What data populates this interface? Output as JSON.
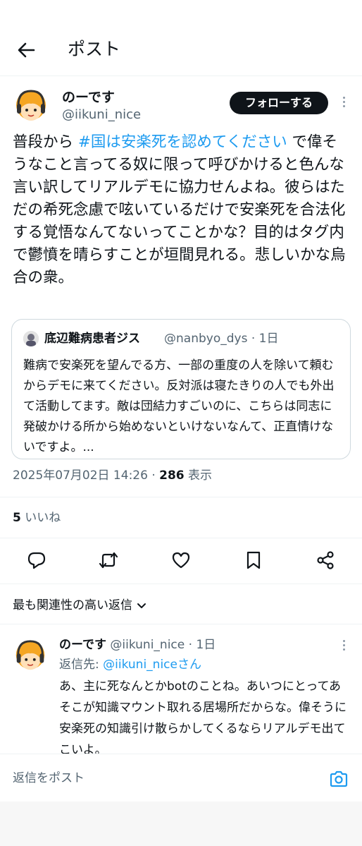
{
  "header": {
    "title": "ポスト"
  },
  "post": {
    "author": {
      "name": "のーです",
      "handle": "@iikuni_nice"
    },
    "follow_label": "フォローする",
    "text_before": "普段から ",
    "hashtag": "#国は安楽死を認めてください",
    "text_after": " で偉そうなこと言ってる奴に限って呼びかけると色んな言い訳してリアルデモに協力せんよね。彼らはただの希死念慮で呟いているだけで安楽死を合法化する覚悟なんてないってことかな？目的はタグ内で鬱憤を晴らすことが垣間見れる。悲しいかな烏合の衆。",
    "quote": {
      "name": "底辺難病患者ジス",
      "meta": "@nanbyo_dys · 1日",
      "text": "難病で安楽死を望んでる方、一部の重度の人を除いて頼むからデモに来てください。反対派は寝たきりの人でも外出て活動してます。敵は団結力すごいのに、こちらは同志に発破かける所から始めないといけないなんて、正直情けないですよ。..."
    },
    "timestamp": "2025年07月02日 14:26 · ",
    "views_count": "286",
    "views_label": " 表示",
    "likes_count": "5",
    "likes_label": " いいね"
  },
  "replies": {
    "sort_label": "最も関連性の高い返信",
    "items": [
      {
        "name": "のーです",
        "meta": " @iikuni_nice · 1日",
        "reply_to_prefix": "返信先: ",
        "reply_to_handle": "@iikuni_niceさん",
        "text": "あ、主に死なんとかbotのことね。あいつにとってあそこが知識マウント取れる居場所だからな。偉そうに安楽死の知識引け散らかしてくるならリアルデモ出てこいよ。"
      }
    ]
  },
  "composer": {
    "placeholder": "返信をポスト"
  },
  "colors": {
    "accent": "#1d9bf0",
    "text": "#0f1419",
    "secondary": "#536471",
    "border": "#cfd9de",
    "avatar_bg": "#f5a623"
  },
  "icons": [
    "back-arrow-icon",
    "more-icon",
    "reply-icon",
    "repost-icon",
    "like-icon",
    "bookmark-icon",
    "share-icon",
    "chevron-down-icon",
    "camera-icon"
  ]
}
